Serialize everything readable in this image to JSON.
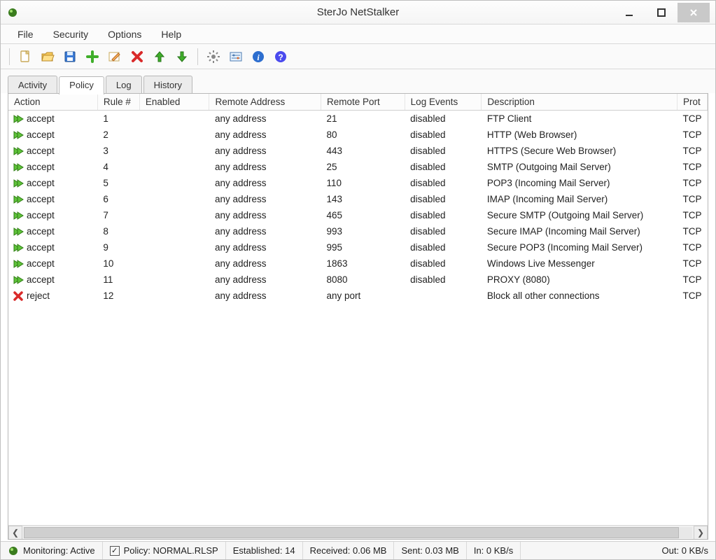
{
  "window": {
    "title": "SterJo NetStalker"
  },
  "menu": {
    "items": [
      "File",
      "Security",
      "Options",
      "Help"
    ]
  },
  "toolbar": {
    "icons": [
      "new-file-icon",
      "open-folder-icon",
      "save-icon",
      "add-icon",
      "edit-icon",
      "delete-icon",
      "arrow-up-icon",
      "arrow-down-icon",
      "gear-icon",
      "settings-slider-icon",
      "info-icon",
      "help-icon"
    ]
  },
  "tabs": {
    "items": [
      "Activity",
      "Policy",
      "Log",
      "History"
    ],
    "active_index": 1
  },
  "table": {
    "headers": [
      "Action",
      "Rule #",
      "Enabled",
      "Remote Address",
      "Remote Port",
      "Log Events",
      "Description",
      "Prot"
    ],
    "rows": [
      {
        "action": "accept",
        "rule": "1",
        "enabled": "",
        "remote_addr": "any address",
        "remote_port": "21",
        "log": "disabled",
        "desc": "FTP Client",
        "prot": "TCP"
      },
      {
        "action": "accept",
        "rule": "2",
        "enabled": "",
        "remote_addr": "any address",
        "remote_port": "80",
        "log": "disabled",
        "desc": "HTTP (Web Browser)",
        "prot": "TCP"
      },
      {
        "action": "accept",
        "rule": "3",
        "enabled": "",
        "remote_addr": "any address",
        "remote_port": "443",
        "log": "disabled",
        "desc": "HTTPS (Secure Web Browser)",
        "prot": "TCP"
      },
      {
        "action": "accept",
        "rule": "4",
        "enabled": "",
        "remote_addr": "any address",
        "remote_port": "25",
        "log": "disabled",
        "desc": "SMTP (Outgoing Mail Server)",
        "prot": "TCP"
      },
      {
        "action": "accept",
        "rule": "5",
        "enabled": "",
        "remote_addr": "any address",
        "remote_port": "110",
        "log": "disabled",
        "desc": "POP3 (Incoming Mail Server)",
        "prot": "TCP"
      },
      {
        "action": "accept",
        "rule": "6",
        "enabled": "",
        "remote_addr": "any address",
        "remote_port": "143",
        "log": "disabled",
        "desc": "IMAP (Incoming Mail Server)",
        "prot": "TCP"
      },
      {
        "action": "accept",
        "rule": "7",
        "enabled": "",
        "remote_addr": "any address",
        "remote_port": "465",
        "log": "disabled",
        "desc": "Secure SMTP (Outgoing Mail Server)",
        "prot": "TCP"
      },
      {
        "action": "accept",
        "rule": "8",
        "enabled": "",
        "remote_addr": "any address",
        "remote_port": "993",
        "log": "disabled",
        "desc": "Secure IMAP (Incoming Mail Server)",
        "prot": "TCP"
      },
      {
        "action": "accept",
        "rule": "9",
        "enabled": "",
        "remote_addr": "any address",
        "remote_port": "995",
        "log": "disabled",
        "desc": "Secure POP3 (Incoming Mail Server)",
        "prot": "TCP"
      },
      {
        "action": "accept",
        "rule": "10",
        "enabled": "",
        "remote_addr": "any address",
        "remote_port": "1863",
        "log": "disabled",
        "desc": "Windows Live Messenger",
        "prot": "TCP"
      },
      {
        "action": "accept",
        "rule": "11",
        "enabled": "",
        "remote_addr": "any address",
        "remote_port": "8080",
        "log": "disabled",
        "desc": "PROXY (8080)",
        "prot": "TCP"
      },
      {
        "action": "reject",
        "rule": "12",
        "enabled": "",
        "remote_addr": "any address",
        "remote_port": "any port",
        "log": "",
        "desc": "Block all other connections",
        "prot": "TCP"
      }
    ]
  },
  "status": {
    "monitoring_label": "Monitoring: Active",
    "policy_label": "Policy: NORMAL.RLSP",
    "established_label": "Established: 14",
    "received_label": "Received: 0.06 MB",
    "sent_label": "Sent: 0.03 MB",
    "in_label": "In: 0 KB/s",
    "out_label": "Out: 0 KB/s"
  }
}
